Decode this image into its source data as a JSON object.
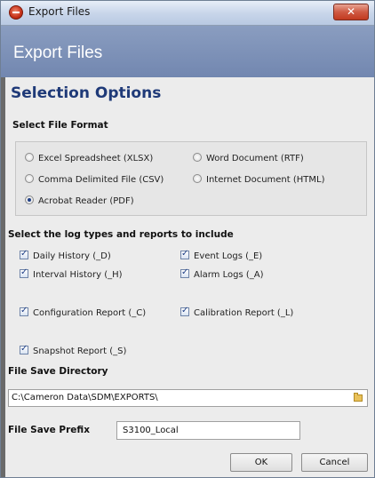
{
  "window": {
    "title": "Export Files",
    "close_label": "✕"
  },
  "header": {
    "title": "Export Files"
  },
  "selection": {
    "heading": "Selection Options",
    "format_label": "Select File Format",
    "formats": [
      {
        "label": "Excel Spreadsheet (XLSX)",
        "checked": false
      },
      {
        "label": "Word Document (RTF)",
        "checked": false
      },
      {
        "label": "Comma Delimited File (CSV)",
        "checked": false
      },
      {
        "label": "Internet Document (HTML)",
        "checked": false
      },
      {
        "label": "Acrobat Reader (PDF)",
        "checked": true
      }
    ]
  },
  "logs": {
    "label": "Select the log types and reports to include",
    "items": [
      {
        "label": "Daily History (_D)",
        "checked": true
      },
      {
        "label": "Event Logs (_E)",
        "checked": true
      },
      {
        "label": "Interval History (_H)",
        "checked": true
      },
      {
        "label": "Alarm Logs (_A)",
        "checked": true
      },
      {
        "label": "Configuration Report (_C)",
        "checked": true
      },
      {
        "label": "Calibration Report (_L)",
        "checked": true
      },
      {
        "label": "Snapshot Report (_S)",
        "checked": true
      }
    ]
  },
  "save": {
    "dir_label": "File Save Directory",
    "dir_value": "C:\\Cameron Data\\SDM\\EXPORTS\\",
    "prefix_label": "File Save Prefix",
    "prefix_value": "S3100_Local"
  },
  "buttons": {
    "ok": "OK",
    "cancel": "Cancel"
  }
}
